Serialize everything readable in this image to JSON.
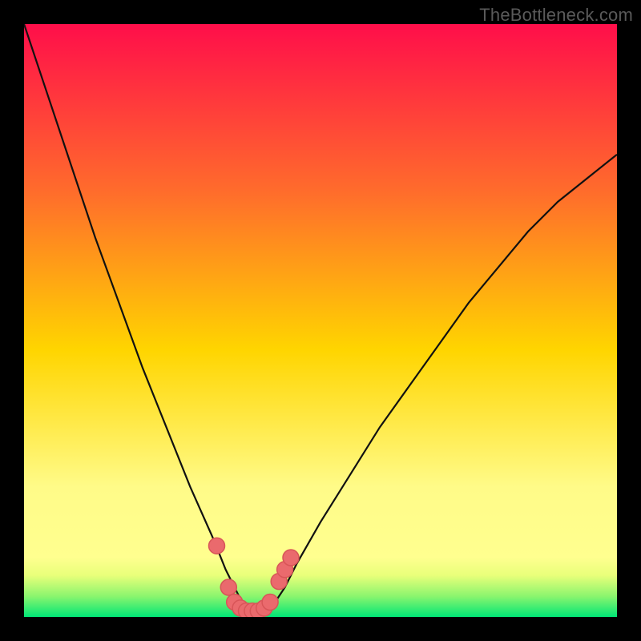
{
  "watermark": "TheBottleneck.com",
  "colors": {
    "bg_black": "#000000",
    "grad_top": "#FF0E4A",
    "grad_mid": "#FFD500",
    "grad_yellow_band": "#FFFB88",
    "grad_green": "#00E676",
    "curve": "#111111",
    "markers_fill": "#EA6A6D",
    "markers_stroke": "#D85558"
  },
  "chart_data": {
    "type": "line",
    "title": "",
    "xlabel": "",
    "ylabel": "",
    "xlim": [
      0,
      100
    ],
    "ylim": [
      0,
      100
    ],
    "series": [
      {
        "name": "bottleneck-curve",
        "x": [
          0,
          4,
          8,
          12,
          16,
          20,
          24,
          28,
          32,
          34,
          35,
          36,
          37,
          38,
          39,
          40,
          41,
          42,
          43,
          44,
          46,
          50,
          55,
          60,
          65,
          70,
          75,
          80,
          85,
          90,
          95,
          100
        ],
        "y": [
          100,
          88,
          76,
          64,
          53,
          42,
          32,
          22,
          13,
          8,
          6,
          4,
          2,
          1,
          0.5,
          0.5,
          0.8,
          2,
          3.5,
          5,
          9,
          16,
          24,
          32,
          39,
          46,
          53,
          59,
          65,
          70,
          74,
          78
        ]
      }
    ],
    "markers": [
      {
        "x": 32.5,
        "y": 12
      },
      {
        "x": 34.5,
        "y": 5
      },
      {
        "x": 35.5,
        "y": 2.5
      },
      {
        "x": 36.5,
        "y": 1.5
      },
      {
        "x": 37.5,
        "y": 1
      },
      {
        "x": 38.5,
        "y": 1
      },
      {
        "x": 39.5,
        "y": 1
      },
      {
        "x": 40.5,
        "y": 1.5
      },
      {
        "x": 41.5,
        "y": 2.5
      },
      {
        "x": 43.0,
        "y": 6
      },
      {
        "x": 44.0,
        "y": 8
      },
      {
        "x": 45.0,
        "y": 10
      }
    ],
    "gradient_bands": [
      {
        "pos": 0,
        "color": "#FF0E4A"
      },
      {
        "pos": 0.28,
        "color": "#FF6B2C"
      },
      {
        "pos": 0.55,
        "color": "#FFD500"
      },
      {
        "pos": 0.78,
        "color": "#FFFB88"
      },
      {
        "pos": 0.9,
        "color": "#FFFF8F"
      },
      {
        "pos": 0.93,
        "color": "#E8FF7A"
      },
      {
        "pos": 0.965,
        "color": "#8BF56E"
      },
      {
        "pos": 1.0,
        "color": "#00E676"
      }
    ]
  }
}
